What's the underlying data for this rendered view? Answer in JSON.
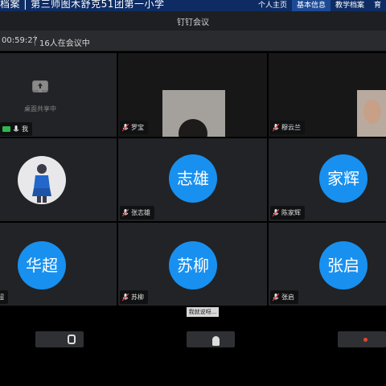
{
  "site_nav": {
    "school": "档案 | 第三师图木舒克51团第一小学",
    "links": [
      "个人主页",
      "基本信息",
      "教学档案",
      "育"
    ]
  },
  "window_title": "钉钉会议",
  "meeting": {
    "timer": "00:59:27",
    "participants_text": "16人在会议中"
  },
  "screen_share": {
    "label": "桌面共享中",
    "owner": "我"
  },
  "participants": [
    {
      "name": "罗宝",
      "type": "video"
    },
    {
      "name": "穆云兰",
      "type": "video"
    },
    {
      "name": "",
      "type": "photo-avatar"
    },
    {
      "name": "张志雄",
      "avatar_text": "志雄"
    },
    {
      "name": "陈家辉",
      "avatar_text": "家辉"
    },
    {
      "name": "超",
      "avatar_text": "华超"
    },
    {
      "name": "苏柳",
      "avatar_text": "苏柳"
    },
    {
      "name": "张启",
      "avatar_text": "张启"
    }
  ],
  "fragment_text": "我就说呀..."
}
